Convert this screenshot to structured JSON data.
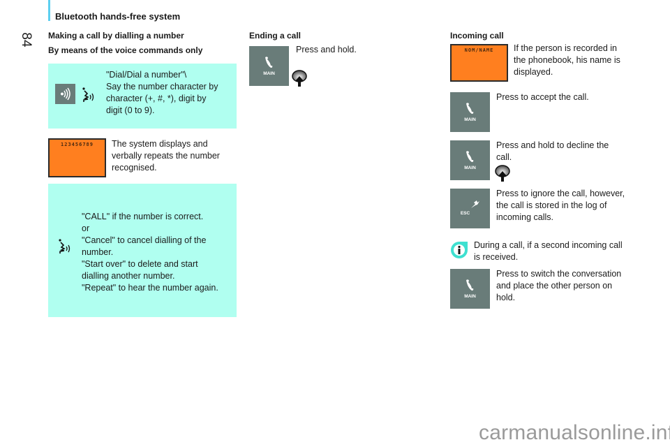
{
  "header": {
    "section_title": "Bluetooth hands-free system",
    "page_number": "84",
    "accent_color": "#5ccff0"
  },
  "left_column": {
    "heading": "Making a call by dialling a number",
    "subheading": "By means of the voice commands only",
    "step1": {
      "button_icon": "voice-command-icon",
      "speech_icon": "speaking-head-icon",
      "lines": [
        "\"Dial/Dial a number\"\\",
        "Say the number character by",
        "character (+, #, *), digit by",
        "digit (0 to 9)."
      ]
    },
    "step2": {
      "display_text": "123456789",
      "lines": [
        "The system displays and",
        "verbally repeats the number",
        "recognised."
      ]
    },
    "step3": {
      "speech_icon": "speaking-head-icon",
      "lines": [
        "\"CALL\" if the number is correct.",
        "or",
        "\"Cancel\" to cancel dialling of the",
        "number.",
        "\"Start over\" to delete and start",
        "dialling another number.",
        "\"Repeat\" to hear the number again."
      ]
    }
  },
  "middle_column": {
    "heading": "Ending a call",
    "button_label": "MAIN",
    "text": "Press and hold."
  },
  "right_column": {
    "heading": "Incoming call",
    "display_text": "NOM/NAME",
    "display_lines": [
      "If the person is recorded in",
      "the phonebook, his name is",
      "displayed."
    ],
    "accept": {
      "button_label": "MAIN",
      "lines": [
        "Press to accept the call."
      ]
    },
    "decline": {
      "button_label": "MAIN",
      "lines": [
        "Press and hold to decline the",
        "call."
      ]
    },
    "ignore": {
      "button_label": "ESC",
      "lines": [
        "Press to ignore the call, however,",
        "the call is stored in the log of",
        "incoming calls."
      ]
    },
    "info": {
      "lines": [
        "During a call, if a second incoming call",
        "is received."
      ]
    },
    "switch": {
      "button_label": "MAIN",
      "lines": [
        "Press to switch the conversation",
        "and place the other person on",
        "hold."
      ]
    }
  },
  "colors": {
    "cyan_box": "#b0fff0",
    "button_gray": "#697c79",
    "display_orange": "#ff7f1f",
    "info_cyan": "#3fe0d0"
  },
  "watermark": "carmanualsonline.info"
}
